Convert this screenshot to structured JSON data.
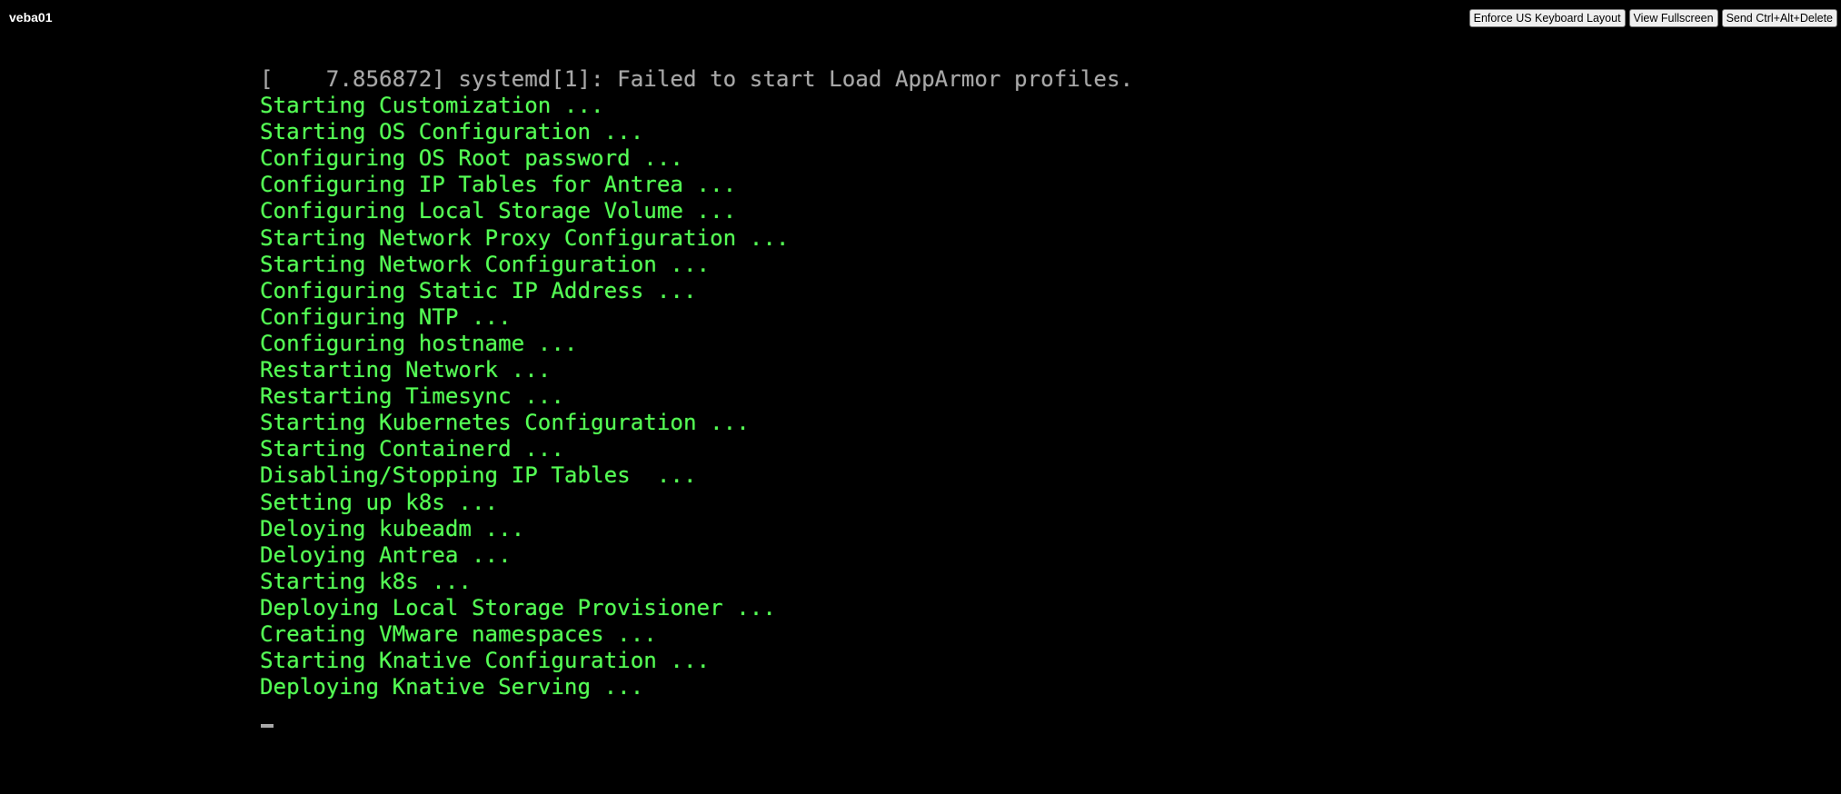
{
  "window": {
    "vm_name": "veba01"
  },
  "toolbar": {
    "enforce_keyboard_label": "Enforce US Keyboard Layout",
    "fullscreen_label": "View Fullscreen",
    "ctrl_alt_del_label": "Send Ctrl+Alt+Delete"
  },
  "console": {
    "lines": [
      {
        "text": "[    7.856872] systemd[1]: Failed to start Load AppArmor profiles.",
        "color": "#a8a8a8"
      },
      {
        "text": "Starting Customization ...",
        "color": "#55ff55"
      },
      {
        "text": "Starting OS Configuration ...",
        "color": "#55ff55"
      },
      {
        "text": "Configuring OS Root password ...",
        "color": "#55ff55"
      },
      {
        "text": "Configuring IP Tables for Antrea ...",
        "color": "#55ff55"
      },
      {
        "text": "Configuring Local Storage Volume ...",
        "color": "#55ff55"
      },
      {
        "text": "Starting Network Proxy Configuration ...",
        "color": "#55ff55"
      },
      {
        "text": "Starting Network Configuration ...",
        "color": "#55ff55"
      },
      {
        "text": "Configuring Static IP Address ...",
        "color": "#55ff55"
      },
      {
        "text": "Configuring NTP ...",
        "color": "#55ff55"
      },
      {
        "text": "Configuring hostname ...",
        "color": "#55ff55"
      },
      {
        "text": "Restarting Network ...",
        "color": "#55ff55"
      },
      {
        "text": "Restarting Timesync ...",
        "color": "#55ff55"
      },
      {
        "text": "Starting Kubernetes Configuration ...",
        "color": "#55ff55"
      },
      {
        "text": "Starting Containerd ...",
        "color": "#55ff55"
      },
      {
        "text": "Disabling/Stopping IP Tables  ...",
        "color": "#55ff55"
      },
      {
        "text": "Setting up k8s ...",
        "color": "#55ff55"
      },
      {
        "text": "Deloying kubeadm ...",
        "color": "#55ff55"
      },
      {
        "text": "Deloying Antrea ...",
        "color": "#55ff55"
      },
      {
        "text": "Starting k8s ...",
        "color": "#55ff55"
      },
      {
        "text": "Deploying Local Storage Provisioner ...",
        "color": "#55ff55"
      },
      {
        "text": "Creating VMware namespaces ...",
        "color": "#55ff55"
      },
      {
        "text": "Starting Knative Configuration ...",
        "color": "#55ff55"
      },
      {
        "text": "Deploying Knative Serving ...",
        "color": "#55ff55"
      }
    ]
  }
}
